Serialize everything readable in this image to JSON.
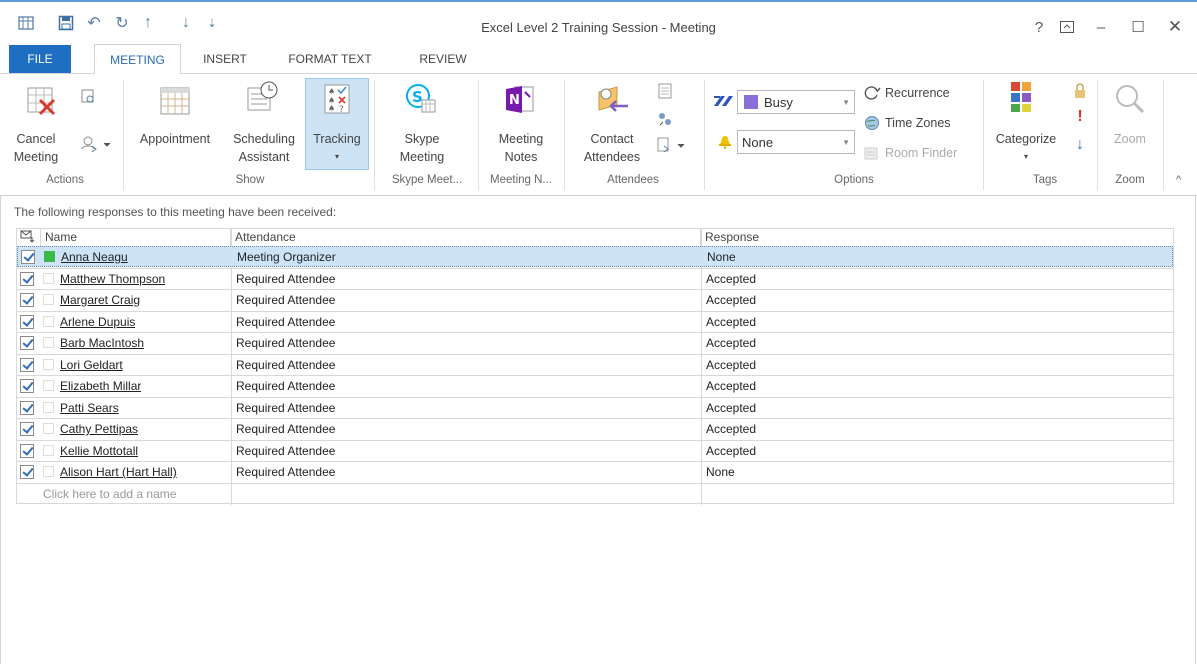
{
  "window": {
    "title": "Excel Level 2 Training Session - Meeting",
    "help": "?",
    "buttons": [
      "ribbon-display",
      "minimize",
      "maximize",
      "close"
    ]
  },
  "tabs": [
    "FILE",
    "MEETING",
    "INSERT",
    "FORMAT TEXT",
    "REVIEW"
  ],
  "active_tab": "MEETING",
  "ribbon": {
    "actions": {
      "label": "Actions",
      "cancel_line1": "Cancel",
      "cancel_line2": "Meeting"
    },
    "show": {
      "label": "Show",
      "appointment": "Appointment",
      "scheduling_line1": "Scheduling",
      "scheduling_line2": "Assistant",
      "tracking": "Tracking"
    },
    "skype": {
      "label": "Skype Meet...",
      "btn_line1": "Skype",
      "btn_line2": "Meeting"
    },
    "notes": {
      "label": "Meeting N...",
      "btn_line1": "Meeting",
      "btn_line2": "Notes"
    },
    "attendees": {
      "label": "Attendees",
      "contact_line1": "Contact",
      "contact_line2": "Attendees"
    },
    "options": {
      "label": "Options",
      "show_as": "Busy",
      "reminder": "None",
      "recurrence": "Recurrence",
      "time_zones": "Time Zones",
      "room_finder": "Room Finder"
    },
    "tags": {
      "label": "Tags",
      "categorize": "Categorize"
    },
    "zoom": {
      "label": "Zoom",
      "btn": "Zoom"
    }
  },
  "message": "The following responses to this meeting have been received:",
  "table": {
    "headers": {
      "name": "Name",
      "attendance": "Attendance",
      "response": "Response"
    },
    "rows": [
      {
        "name": "Anna Neagu",
        "attendance": "Meeting Organizer",
        "response": "None",
        "organizer": true
      },
      {
        "name": "Matthew Thompson",
        "attendance": "Required Attendee",
        "response": "Accepted"
      },
      {
        "name": "Margaret Craig",
        "attendance": "Required Attendee",
        "response": "Accepted"
      },
      {
        "name": "Arlene Dupuis",
        "attendance": "Required Attendee",
        "response": "Accepted"
      },
      {
        "name": "Barb MacIntosh",
        "attendance": "Required Attendee",
        "response": "Accepted"
      },
      {
        "name": "Lori Geldart",
        "attendance": "Required Attendee",
        "response": "Accepted"
      },
      {
        "name": "Elizabeth Millar",
        "attendance": "Required Attendee",
        "response": "Accepted"
      },
      {
        "name": "Patti Sears",
        "attendance": "Required Attendee",
        "response": "Accepted"
      },
      {
        "name": "Cathy Pettipas",
        "attendance": "Required Attendee",
        "response": "Accepted"
      },
      {
        "name": "Kellie Mottotall",
        "attendance": "Required Attendee",
        "response": "Accepted"
      },
      {
        "name": "Alison Hart (Hart Hall)",
        "attendance": "Required Attendee",
        "response": "None"
      }
    ],
    "add_placeholder": "Click here to add a name"
  },
  "colors": {
    "accent": "#1e6fc1",
    "selection": "#cde4f7",
    "organizer": "#3cb84a",
    "busy": "#8a6fd6",
    "reminder": "#f0c000"
  }
}
